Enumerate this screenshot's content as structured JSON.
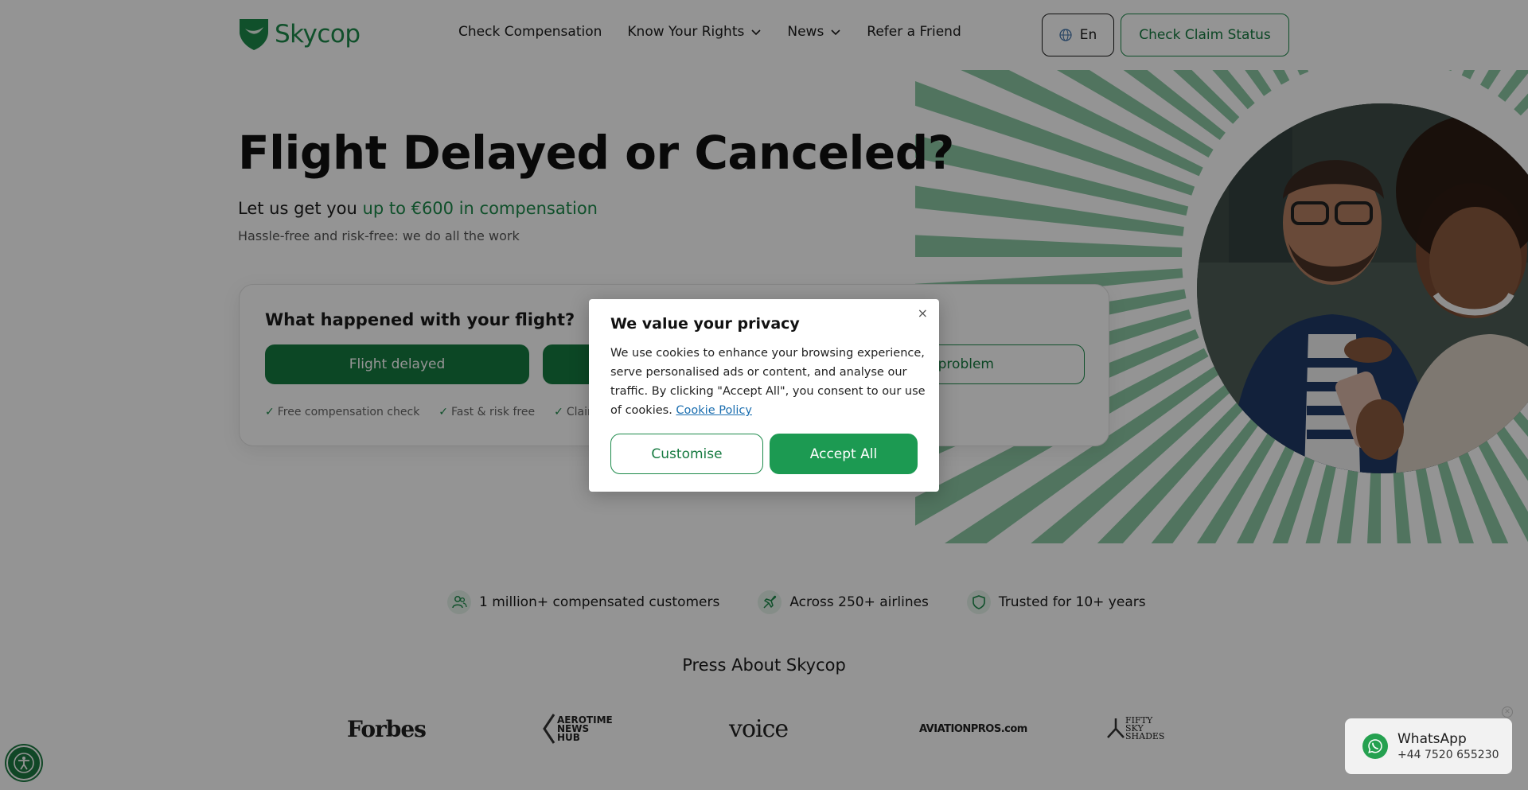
{
  "header": {
    "logo_text": "Skycop",
    "nav": [
      {
        "label": "Check Compensation",
        "dropdown": false
      },
      {
        "label": "Know Your Rights",
        "dropdown": true
      },
      {
        "label": "News",
        "dropdown": true
      },
      {
        "label": "Refer a Friend",
        "dropdown": false
      }
    ],
    "language": "En",
    "claim_status_label": "Check Claim Status"
  },
  "hero": {
    "title": "Flight Delayed or Canceled?",
    "subtitle_prefix": "Let us get you ",
    "subtitle_accent": "up to €600 in compensation",
    "note": "Hassle-free and risk-free: we do all the work"
  },
  "flight_card": {
    "title": "What happened with your flight?",
    "options": [
      "Flight delayed",
      "F",
      "ght problem"
    ],
    "checks": [
      "Free compensation check",
      "Fast & risk free",
      "Claim"
    ]
  },
  "stats": [
    {
      "icon": "users-icon",
      "label": "1 million+ compensated customers"
    },
    {
      "icon": "plane-icon",
      "label": "Across 250+ airlines"
    },
    {
      "icon": "shield-icon",
      "label": "Trusted for 10+ years"
    }
  ],
  "press": {
    "title": "Press About Skycop",
    "logos": [
      "Forbes",
      "AEROTIME NEWS HUB",
      "aviation voice",
      "AVIATIONPROS.com",
      "FIFTY SKY SHADES"
    ]
  },
  "cookie_dialog": {
    "title": "We value your privacy",
    "text": "We use cookies to enhance your browsing experience, serve personalised ads or content, and analyse our traffic. By clicking \"Accept All\", you consent to our use of cookies. ",
    "link": "Cookie Policy",
    "customise_label": "Customise",
    "accept_label": "Accept All",
    "close_glyph": "×"
  },
  "whatsapp": {
    "name": "WhatsApp",
    "phone": "+44 7520 655230"
  },
  "colors": {
    "brand_green": "#1c8a4a",
    "button_green": "#167a40",
    "accept_green": "#1c9a52",
    "overlay": "rgba(0,0,0,0.42)"
  }
}
